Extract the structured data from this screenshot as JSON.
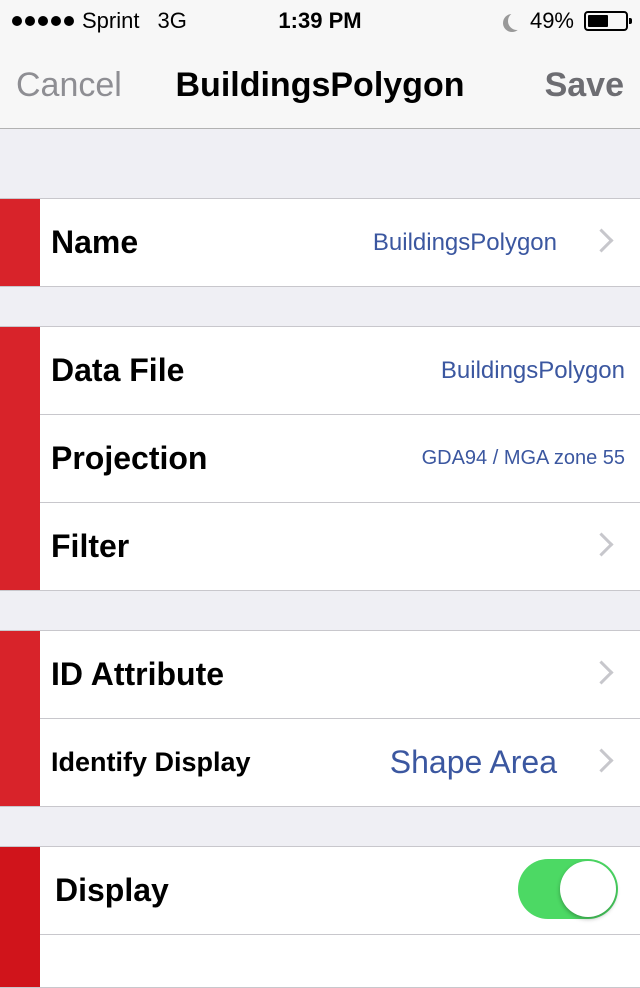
{
  "status_bar": {
    "carrier": "Sprint",
    "network": "3G",
    "time": "1:39 PM",
    "battery_percent": "49%",
    "battery_level": 0.49,
    "icons": [
      "signal-dots-icon",
      "moon-icon",
      "battery-icon"
    ]
  },
  "nav": {
    "cancel_label": "Cancel",
    "title": "BuildingsPolygon",
    "save_label": "Save"
  },
  "sections": {
    "name": {
      "label": "Name",
      "value": "BuildingsPolygon"
    },
    "data_file": {
      "label": "Data File",
      "value": "BuildingsPolygon"
    },
    "projection": {
      "label": "Projection",
      "value": "GDA94 / MGA zone 55"
    },
    "filter": {
      "label": "Filter"
    },
    "id_attribute": {
      "label": "ID Attribute"
    },
    "identify_display": {
      "label": "Identify Display",
      "value": "Shape Area"
    },
    "display": {
      "label": "Display",
      "enabled": true
    }
  },
  "colors": {
    "accent_red": "#d8232a",
    "value_blue": "#3b57a0",
    "toggle_green": "#4cd964",
    "background": "#efeff4"
  }
}
